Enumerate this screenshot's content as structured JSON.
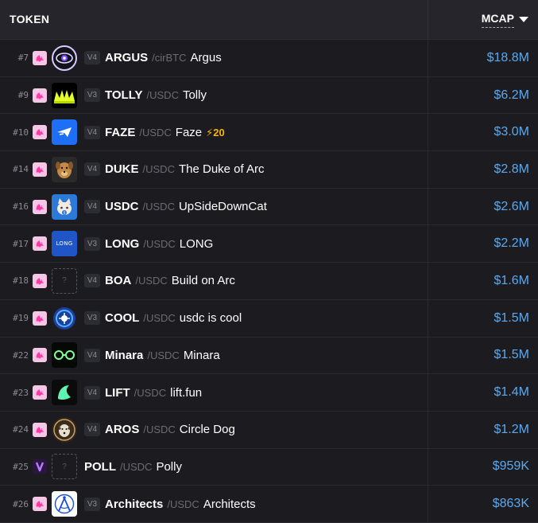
{
  "header": {
    "token_label": "TOKEN",
    "mcap_label": "MCAP"
  },
  "colors": {
    "mcap": "#5aa9f0",
    "boost": "#f5b800",
    "dex_badge": "#f5c6e6"
  },
  "rows": [
    {
      "rank": "#7",
      "dex_icon": "uniswap-icon",
      "logo_icon": "argus-eye-logo",
      "version": "V4",
      "symbol": "ARGUS",
      "pair": "/cirBTC",
      "name": "Argus",
      "mcap": "$18.8M"
    },
    {
      "rank": "#9",
      "dex_icon": "uniswap-icon",
      "logo_icon": "tolly-crown-logo",
      "version": "V3",
      "symbol": "TOLLY",
      "pair": "/USDC",
      "name": "Tolly",
      "mcap": "$6.2M"
    },
    {
      "rank": "#10",
      "dex_icon": "uniswap-icon",
      "logo_icon": "faze-plane-logo",
      "version": "V4",
      "symbol": "FAZE",
      "pair": "/USDC",
      "name": "Faze",
      "boost": "⚡20",
      "mcap": "$3.0M"
    },
    {
      "rank": "#14",
      "dex_icon": "uniswap-icon",
      "logo_icon": "duke-dog-logo",
      "version": "V4",
      "symbol": "DUKE",
      "pair": "/USDC",
      "name": "The Duke of Arc",
      "mcap": "$2.8M"
    },
    {
      "rank": "#16",
      "dex_icon": "uniswap-icon",
      "logo_icon": "usdc-cat-logo",
      "version": "V4",
      "symbol": "USDC",
      "pair": "/USDC",
      "name": "UpSideDownCat",
      "mcap": "$2.6M"
    },
    {
      "rank": "#17",
      "dex_icon": "uniswap-icon",
      "logo_icon": "long-logo",
      "logo_text": "LONG",
      "version": "V3",
      "symbol": "LONG",
      "pair": "/USDC",
      "name": "LONG",
      "mcap": "$2.2M"
    },
    {
      "rank": "#18",
      "dex_icon": "uniswap-icon",
      "logo_icon": "placeholder-logo",
      "logo_text": "?",
      "version": "V4",
      "symbol": "BOA",
      "pair": "/USDC",
      "name": "Build on Arc",
      "mcap": "$1.6M"
    },
    {
      "rank": "#19",
      "dex_icon": "uniswap-icon",
      "logo_icon": "cool-shield-logo",
      "version": "V3",
      "symbol": "COOL",
      "pair": "/USDC",
      "name": "usdc is cool",
      "mcap": "$1.5M"
    },
    {
      "rank": "#22",
      "dex_icon": "uniswap-icon",
      "logo_icon": "minara-logo",
      "version": "V4",
      "symbol": "Minara",
      "pair": "/USDC",
      "name": "Minara",
      "mcap": "$1.5M"
    },
    {
      "rank": "#23",
      "dex_icon": "uniswap-icon",
      "logo_icon": "lift-wave-logo",
      "version": "V4",
      "symbol": "LIFT",
      "pair": "/USDC",
      "name": "lift.fun",
      "mcap": "$1.4M"
    },
    {
      "rank": "#24",
      "dex_icon": "uniswap-icon",
      "logo_icon": "aros-dog-logo",
      "version": "V4",
      "symbol": "AROS",
      "pair": "/USDC",
      "name": "Circle Dog",
      "mcap": "$1.2M"
    },
    {
      "rank": "#25",
      "dex_icon": "linear-icon",
      "logo_icon": "placeholder-logo",
      "logo_text": "?",
      "version": "",
      "symbol": "POLL",
      "pair": "/USDC",
      "name": "Polly",
      "mcap": "$959K"
    },
    {
      "rank": "#26",
      "dex_icon": "uniswap-icon",
      "logo_icon": "architects-compass-logo",
      "version": "V3",
      "symbol": "Architects",
      "pair": "/USDC",
      "name": "Architects",
      "mcap": "$863K"
    }
  ]
}
